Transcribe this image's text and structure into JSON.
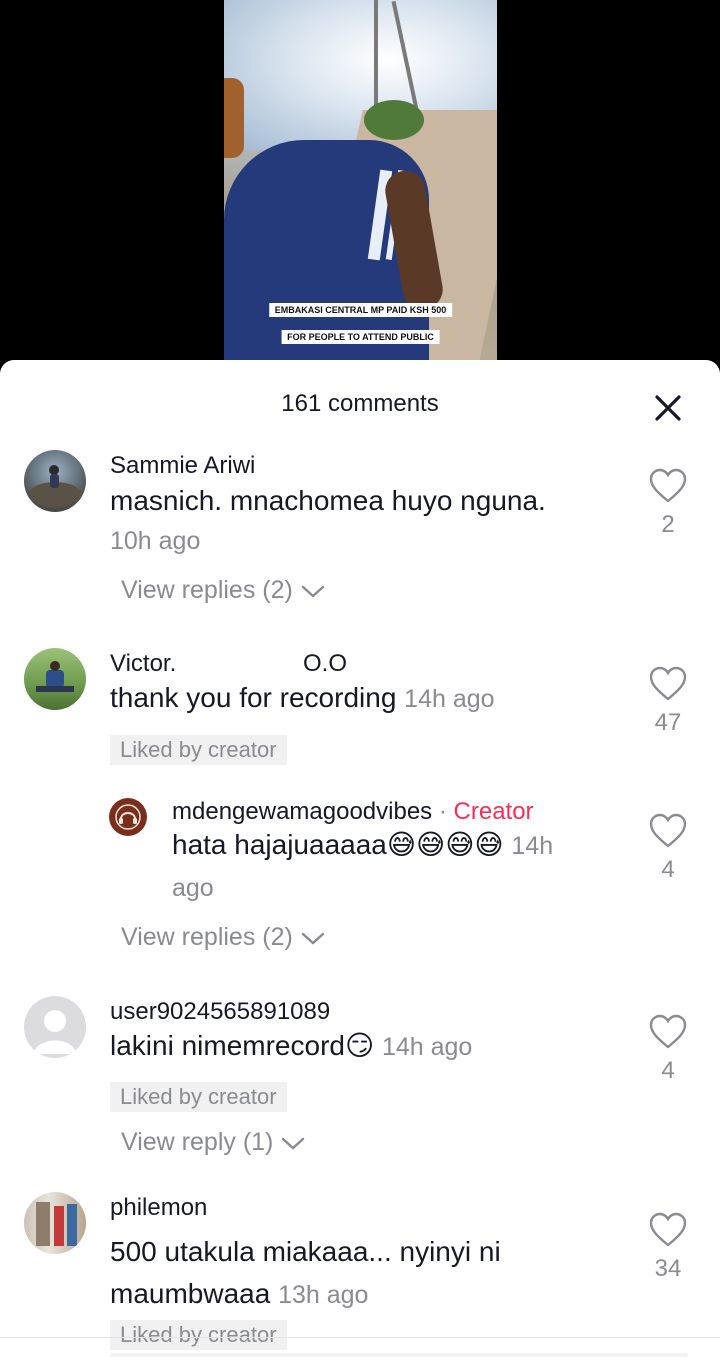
{
  "video": {
    "captions": [
      "EMBAKASI CENTRAL MP PAID KSH 500",
      "FOR PEOPLE TO ATTEND PUBLIC"
    ]
  },
  "sheet": {
    "title": "161 comments",
    "close_icon": "close-icon"
  },
  "comments": [
    {
      "username": "Sammie Ariwi",
      "text": "masnich. mnachomea huyo nguna.",
      "time": "10h ago",
      "likes": "2",
      "view_replies": "View replies (2)"
    },
    {
      "username": "Victor.",
      "username_suffix": "O.O",
      "text": "thank you for recording",
      "time": "14h ago",
      "liked_by": "Liked by creator",
      "likes": "47",
      "reply": {
        "username": "mdengewamagoodvibes",
        "separator": "·",
        "creator_label": "Creator",
        "text": "hata hajajuaaaaa😅😅😅😅",
        "time_part1": "14h",
        "time_part2": "ago",
        "likes": "4"
      },
      "view_replies": "View replies (2)"
    },
    {
      "username": "user9024565891089",
      "text": "lakini nimemrecord😏",
      "time": "14h ago",
      "liked_by": "Liked by creator",
      "likes": "4",
      "view_replies": "View reply (1)"
    },
    {
      "username": "philemon",
      "text_line1": "500 utakula miakaaa... nyinyi ni",
      "text_line2": "maumbwaaa",
      "time": "13h ago",
      "liked_by": "Liked by creator",
      "likes": "34"
    }
  ],
  "colors": {
    "creator": "#fe2c55",
    "secondary_text": "#8a8b91",
    "primary_text": "#161823"
  }
}
